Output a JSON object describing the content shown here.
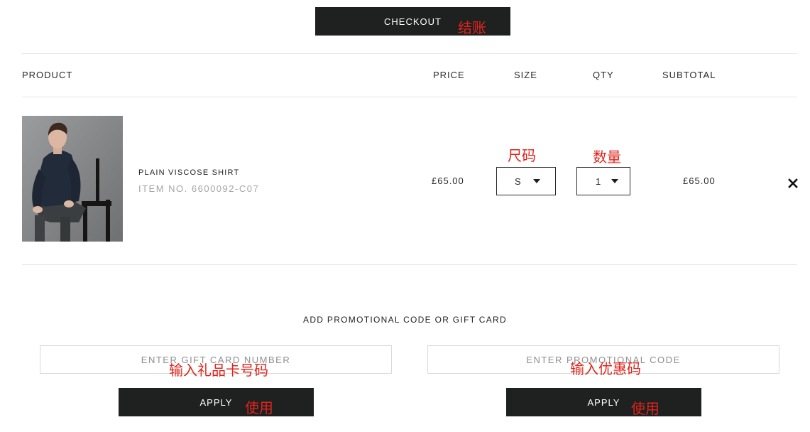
{
  "checkout": {
    "label": "CHECKOUT",
    "annotation": "结账"
  },
  "table": {
    "headers": {
      "product": "PRODUCT",
      "price": "PRICE",
      "size": "SIZE",
      "qty": "QTY",
      "subtotal": "SUBTOTAL"
    }
  },
  "item": {
    "name": "PLAIN VISCOSE SHIRT",
    "item_no": "ITEM NO. 6600092-C07",
    "price": "£65.00",
    "size": {
      "value": "S",
      "annotation": "尺码"
    },
    "qty": {
      "value": "1",
      "annotation": "数量"
    },
    "subtotal": "£65.00",
    "remove_icon": "close-icon"
  },
  "promo": {
    "title": "ADD PROMOTIONAL CODE OR GIFT CARD",
    "gift_card": {
      "placeholder": "ENTER GIFT CARD NUMBER",
      "value": "",
      "annotation": "输入礼品卡号码",
      "apply_label": "APPLY",
      "apply_annotation": "使用"
    },
    "promo_code": {
      "placeholder": "ENTER PROMOTIONAL CODE",
      "value": "",
      "annotation": "输入优惠码",
      "apply_label": "APPLY",
      "apply_annotation": "使用"
    }
  },
  "colors": {
    "button_bg": "#1f2020",
    "annotation": "#e0241b",
    "muted_text": "#a5a5a5",
    "divider": "#e6e6e6"
  }
}
